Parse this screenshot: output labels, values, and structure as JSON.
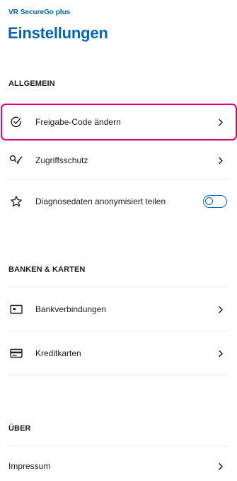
{
  "header": {
    "app_name": "VR SecureGo plus",
    "title": "Einstellungen"
  },
  "sections": {
    "general": {
      "title": "ALLGEMEIN",
      "items": [
        {
          "label": "Freigabe-Code ändern",
          "icon": "check-circle-icon"
        },
        {
          "label": "Zugriffsschutz",
          "icon": "access-protection-icon"
        },
        {
          "label": "Diagnosedaten anonymisiert teilen",
          "icon": "star-icon",
          "toggle_on": false
        }
      ]
    },
    "banks": {
      "title": "BANKEN & KARTEN",
      "items": [
        {
          "label": "Bankverbindungen",
          "icon": "bank-account-icon"
        },
        {
          "label": "Kreditkarten",
          "icon": "credit-card-icon"
        }
      ]
    },
    "about": {
      "title": "ÜBER",
      "items": [
        {
          "label": "Impressum"
        }
      ]
    }
  },
  "colors": {
    "brand": "#0066b3",
    "highlight": "#e0007a",
    "divider": "#e6e6e6"
  }
}
